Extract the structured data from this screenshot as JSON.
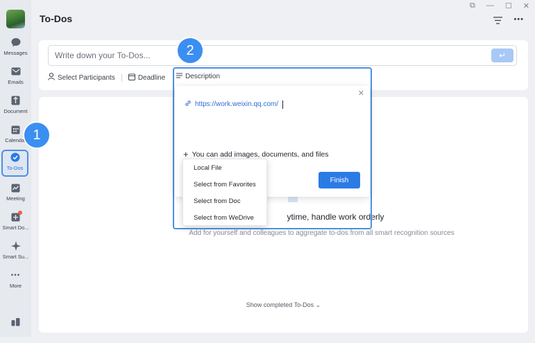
{
  "sidebar": {
    "items": [
      {
        "label": "Messages",
        "icon": "chat-bubble-icon"
      },
      {
        "label": "Emails",
        "icon": "envelope-icon"
      },
      {
        "label": "Document",
        "icon": "document-icon"
      },
      {
        "label": "Calendar",
        "icon": "calendar-icon"
      },
      {
        "label": "To-Dos",
        "icon": "checkmark-circle-icon"
      },
      {
        "label": "Meeting",
        "icon": "meeting-icon"
      },
      {
        "label": "Smart Do...",
        "icon": "smart-doc-icon"
      },
      {
        "label": "Smart Su...",
        "icon": "sparkle-icon"
      },
      {
        "label": "More",
        "icon": "more-dots-icon"
      }
    ]
  },
  "header": {
    "title": "To-Dos"
  },
  "input": {
    "placeholder": "Write down your To-Dos...",
    "select_participants": "Select Participants",
    "deadline": "Deadline",
    "description": "Description"
  },
  "description_popup": {
    "link_text": "https://work.weixin.qq.com/",
    "add_hint": "You can add images, documents, and files",
    "finish_label": "Finish"
  },
  "attach_menu": {
    "items": [
      "Local File",
      "Select from Favorites",
      "Select from Doc",
      "Select from WeDrive"
    ]
  },
  "empty_state": {
    "title": "ytime, handle work orderly",
    "subtitle": "Add for yourself and colleagues to aggregate to-dos from all smart recognition sources"
  },
  "footer": {
    "show_completed": "Show completed To-Dos"
  },
  "annotations": {
    "badge_1": "1",
    "badge_2": "2"
  },
  "colors": {
    "accent": "#2b7be5",
    "highlight_border": "#4a90e2",
    "badge": "#3b8ef2"
  }
}
